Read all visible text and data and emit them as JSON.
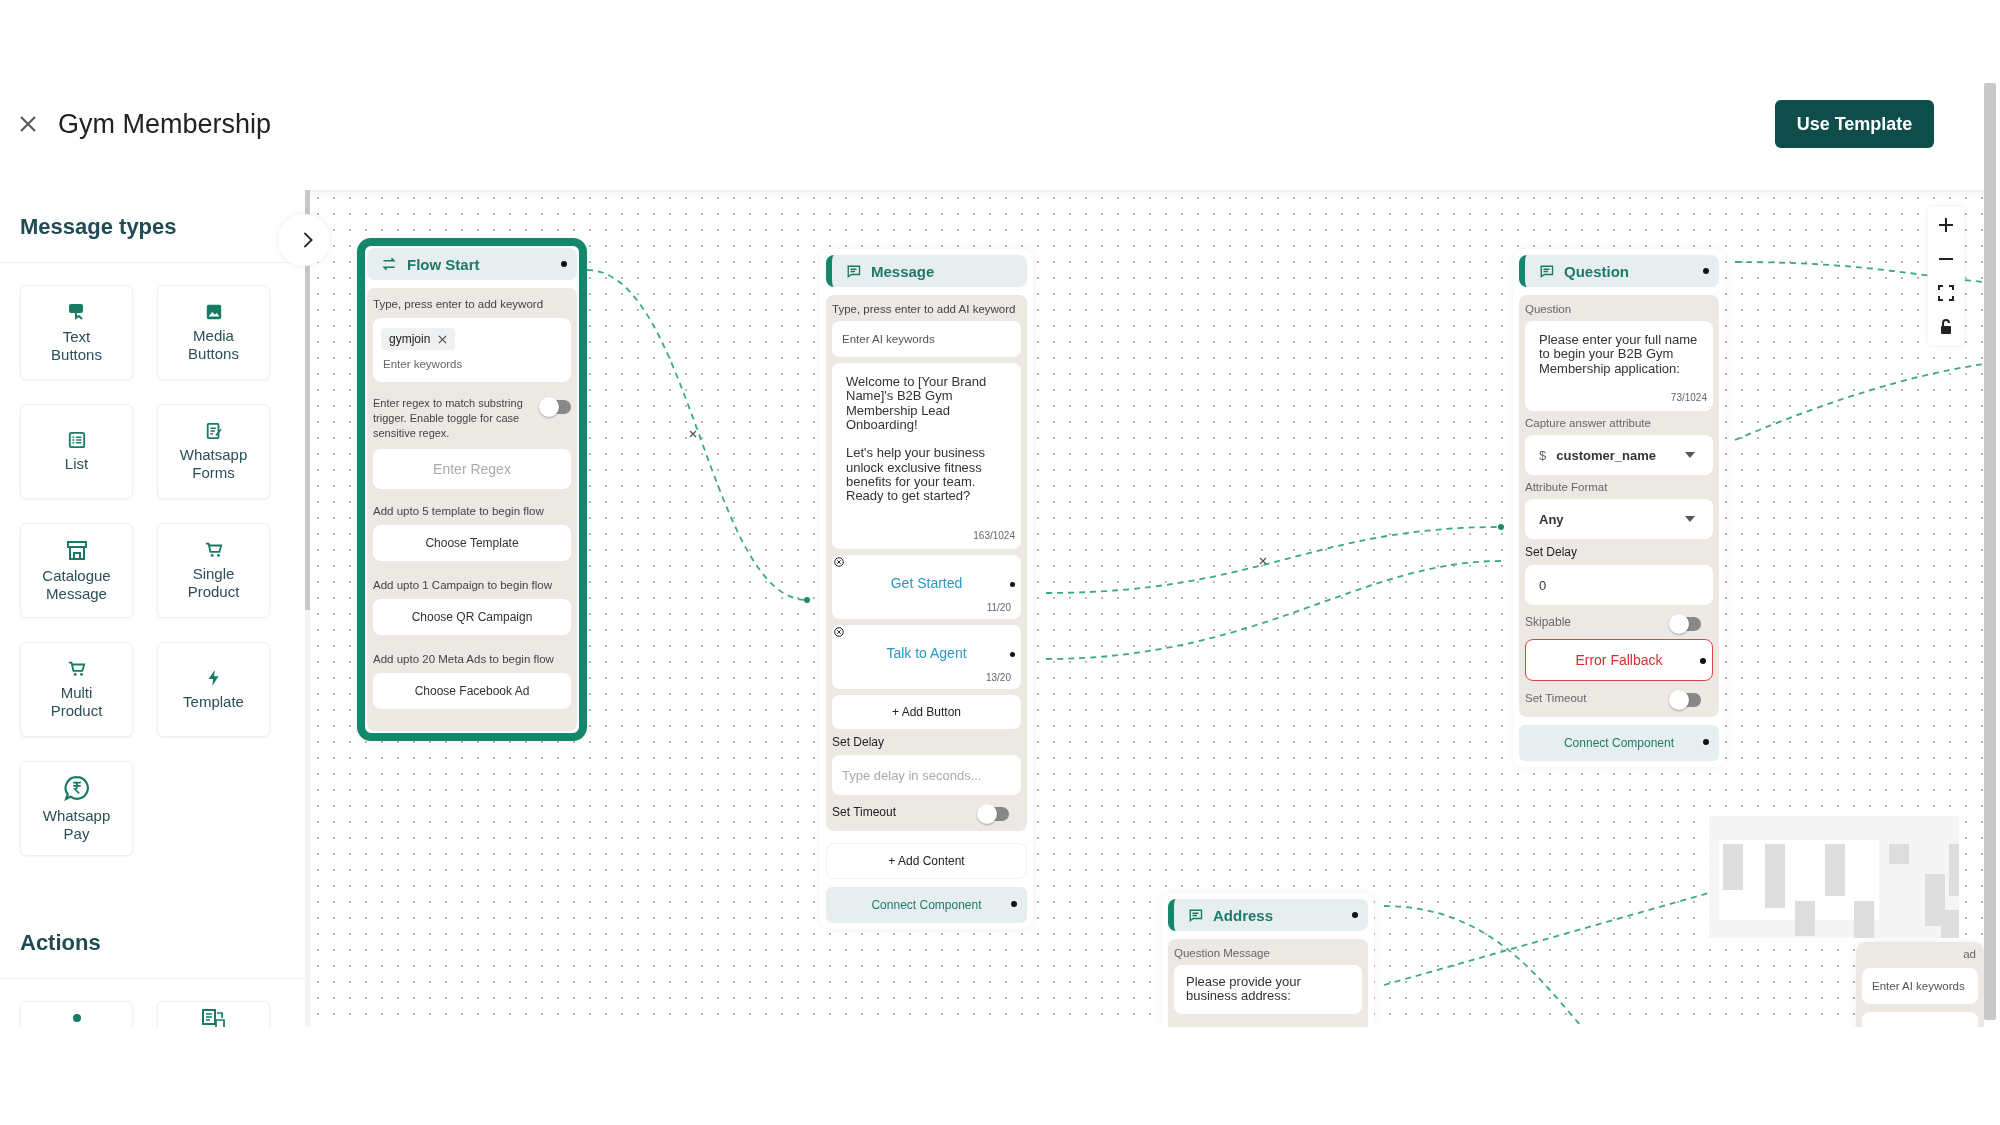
{
  "header": {
    "title": "Gym Membership",
    "action": "Use Template"
  },
  "sidebar": {
    "sections": [
      {
        "title": "Message types",
        "items": [
          {
            "kind": "labeled",
            "label": "Text Buttons"
          },
          {
            "kind": "labeled",
            "label": "Media Buttons"
          },
          {
            "kind": "labeled",
            "label": "List"
          },
          {
            "kind": "labeled",
            "label": "Whatsapp Forms"
          },
          {
            "kind": "labeled",
            "label": "Catalogue Message"
          },
          {
            "kind": "labeled",
            "label": "Single Product"
          },
          {
            "kind": "labeled",
            "label": "Multi Product"
          },
          {
            "kind": "labeled",
            "label": "Template"
          },
          {
            "kind": "labeled",
            "label": "Whatsapp Pay"
          }
        ]
      },
      {
        "title": "Actions",
        "items": [
          {
            "kind": "icon-only"
          },
          {
            "kind": "icon-only"
          }
        ]
      }
    ]
  },
  "flow_start": {
    "title": "Flow Start",
    "selected": true,
    "keyword_label": "Type, press enter to add keyword",
    "keywords": [
      "gymjoin"
    ],
    "keyword_placeholder": "Enter keywords",
    "regex_hint": "Enter regex to match substring trigger. Enable toggle for case sensitive regex.",
    "regex_case_sensitive": false,
    "regex_placeholder": "Enter Regex",
    "starters": [
      {
        "hint": "Add upto 5 template to begin flow",
        "button": "Choose Template"
      },
      {
        "hint": "Add upto 1 Campaign to begin flow",
        "button": "Choose QR Campaign"
      },
      {
        "hint": "Add upto 20 Meta Ads to begin flow",
        "button": "Choose Facebook Ad"
      }
    ]
  },
  "message": {
    "title": "Message",
    "ai_keyword_label": "Type, press enter to add AI keyword",
    "ai_keyword_placeholder": "Enter AI keywords",
    "body": "Welcome to [Your Brand Name]'s B2B Gym Membership Lead Onboarding!\n\nLet's help your business unlock exclusive fitness benefits for your team. Ready to get started?",
    "body_count": "163/1024",
    "buttons": [
      {
        "label": "Get Started",
        "count": "11/20"
      },
      {
        "label": "Talk to Agent",
        "count": "13/20"
      }
    ],
    "add_button": "+ Add Button",
    "delay_label": "Set Delay",
    "delay_placeholder": "Type delay in seconds...",
    "timeout_label": "Set Timeout",
    "timeout_on": false,
    "add_content": "+ Add Content",
    "connect": "Connect Component"
  },
  "question": {
    "title": "Question",
    "question_label": "Question",
    "question_text": "Please enter your full name to begin your B2B Gym Membership application:",
    "question_count": "73/1024",
    "capture_label": "Capture answer attribute",
    "attribute_prefix": "$",
    "attribute_value": "customer_name",
    "format_label": "Attribute Format",
    "format_value": "Any",
    "delay_label": "Set Delay",
    "delay_value": "0",
    "skipable_label": "Skipable",
    "skipable": false,
    "fallback": "Error Fallback",
    "timeout_label": "Set Timeout",
    "timeout_on": false,
    "connect": "Connect Component"
  },
  "address": {
    "title": "Address",
    "question_label": "Question Message",
    "question_text": "Please provide your business address:"
  },
  "partial_node": {
    "label": "ad",
    "ai_keyword_placeholder": "Enter AI keywords"
  }
}
